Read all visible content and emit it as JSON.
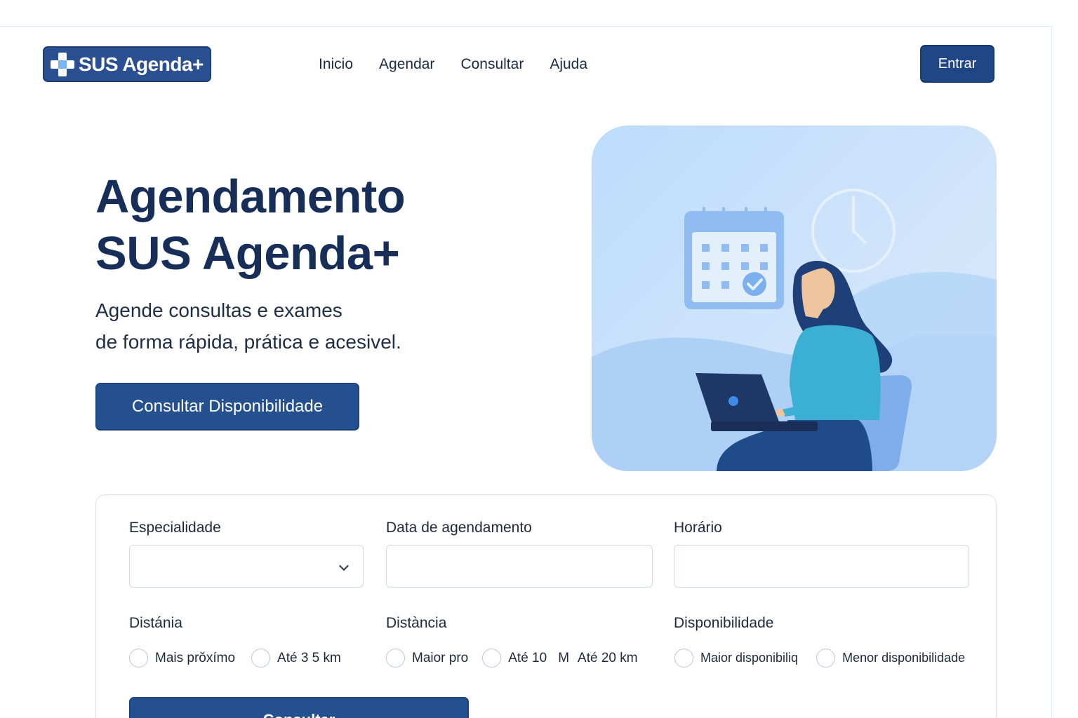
{
  "header": {
    "logo_text": "SUS Agenda+",
    "nav": [
      "Inicio",
      "Agendar",
      "Consultar",
      "Ajuda"
    ],
    "login_label": "Entrar"
  },
  "hero": {
    "title_line1": "Agendamento",
    "title_line2": "SUS Agenda+",
    "subtitle_line1": "Agende consultas e exames",
    "subtitle_line2": "de forma rápida, prática e acesivel.",
    "cta_label": "Consultar Disponibilidade",
    "illustration_icons": [
      "calendar-icon",
      "clock-icon",
      "check-icon",
      "laptop-icon",
      "person-icon"
    ]
  },
  "form": {
    "especialidade_label": "Especialidade",
    "especialidade_value": "",
    "data_label": "Data de agendamento",
    "data_value": "",
    "horario_label": "Horário",
    "horario_value": "",
    "distancia1_label": "Distánia",
    "distancia1_options": [
      "Mais prŏxímo",
      "Até 3 5 km"
    ],
    "distancia2_label": "Distància",
    "distancia2_options": [
      "Maior pro",
      "Até 10",
      "M",
      "Até 20 km"
    ],
    "disponibilidade_label": "Disponibilidade",
    "disponibilidade_options": [
      "Maior disponibiliq",
      "Menor disponibilidade"
    ],
    "submit_label": "Consultar"
  },
  "colors": {
    "primary": "#24508f",
    "dark_text": "#172f58",
    "illustration_bg": "#c4defb"
  }
}
